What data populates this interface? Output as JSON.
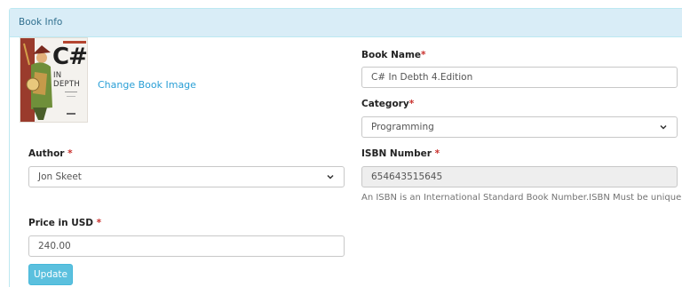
{
  "panel": {
    "title": "Book Info"
  },
  "cover": {
    "title_big": "C#",
    "title_small": "IN DEPTH",
    "change_label": "Change Book Image"
  },
  "book_name": {
    "label": "Book Name",
    "required": "*",
    "value": "C# In Debth 4.Edition"
  },
  "category": {
    "label": "Category",
    "required": "*",
    "value": "Programming"
  },
  "author": {
    "label": "Author",
    "required": " *",
    "value": "Jon Skeet"
  },
  "isbn": {
    "label": "ISBN Number",
    "required": " *",
    "value": "654643515645",
    "help": "An ISBN is an International Standard Book Number.ISBN Must be unique"
  },
  "price": {
    "label": "Price in USD",
    "required": " *",
    "value": "240.00"
  },
  "actions": {
    "update_label": "Update"
  },
  "colors": {
    "heading_bg": "#d9edf7",
    "link": "#2a9fd6",
    "button": "#5bc0de",
    "required": "#c9302c"
  }
}
